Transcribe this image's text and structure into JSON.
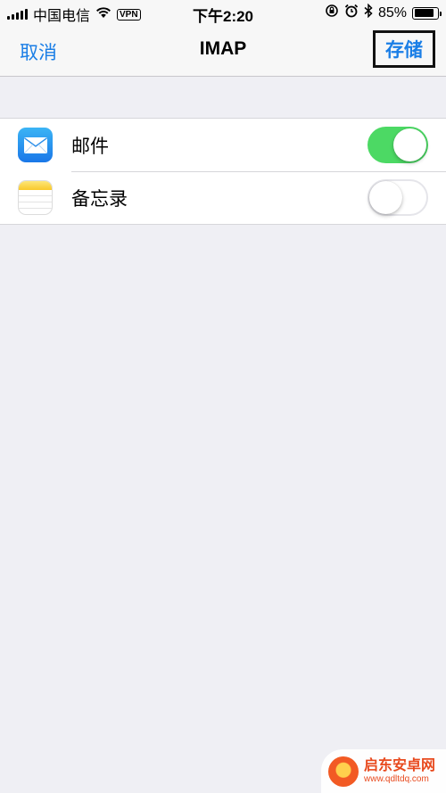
{
  "status_bar": {
    "carrier": "中国电信",
    "vpn": "VPN",
    "time": "下午2:20",
    "battery_percent": "85%",
    "battery_level": 0.85,
    "icons": [
      "signal-icon",
      "wifi-icon",
      "orientation-lock-icon",
      "alarm-icon",
      "bluetooth-icon",
      "battery-icon"
    ]
  },
  "nav": {
    "cancel_label": "取消",
    "title": "IMAP",
    "save_label": "存储"
  },
  "items": [
    {
      "label": "邮件",
      "icon": "mail-app-icon",
      "enabled": true
    },
    {
      "label": "备忘录",
      "icon": "notes-app-icon",
      "enabled": false
    }
  ],
  "colors": {
    "accent": "#1a7ee6",
    "toggle_on": "#4cd964",
    "background": "#efeff4"
  },
  "watermark": {
    "name": "启东安卓网",
    "url": "www.qdltdq.com"
  }
}
